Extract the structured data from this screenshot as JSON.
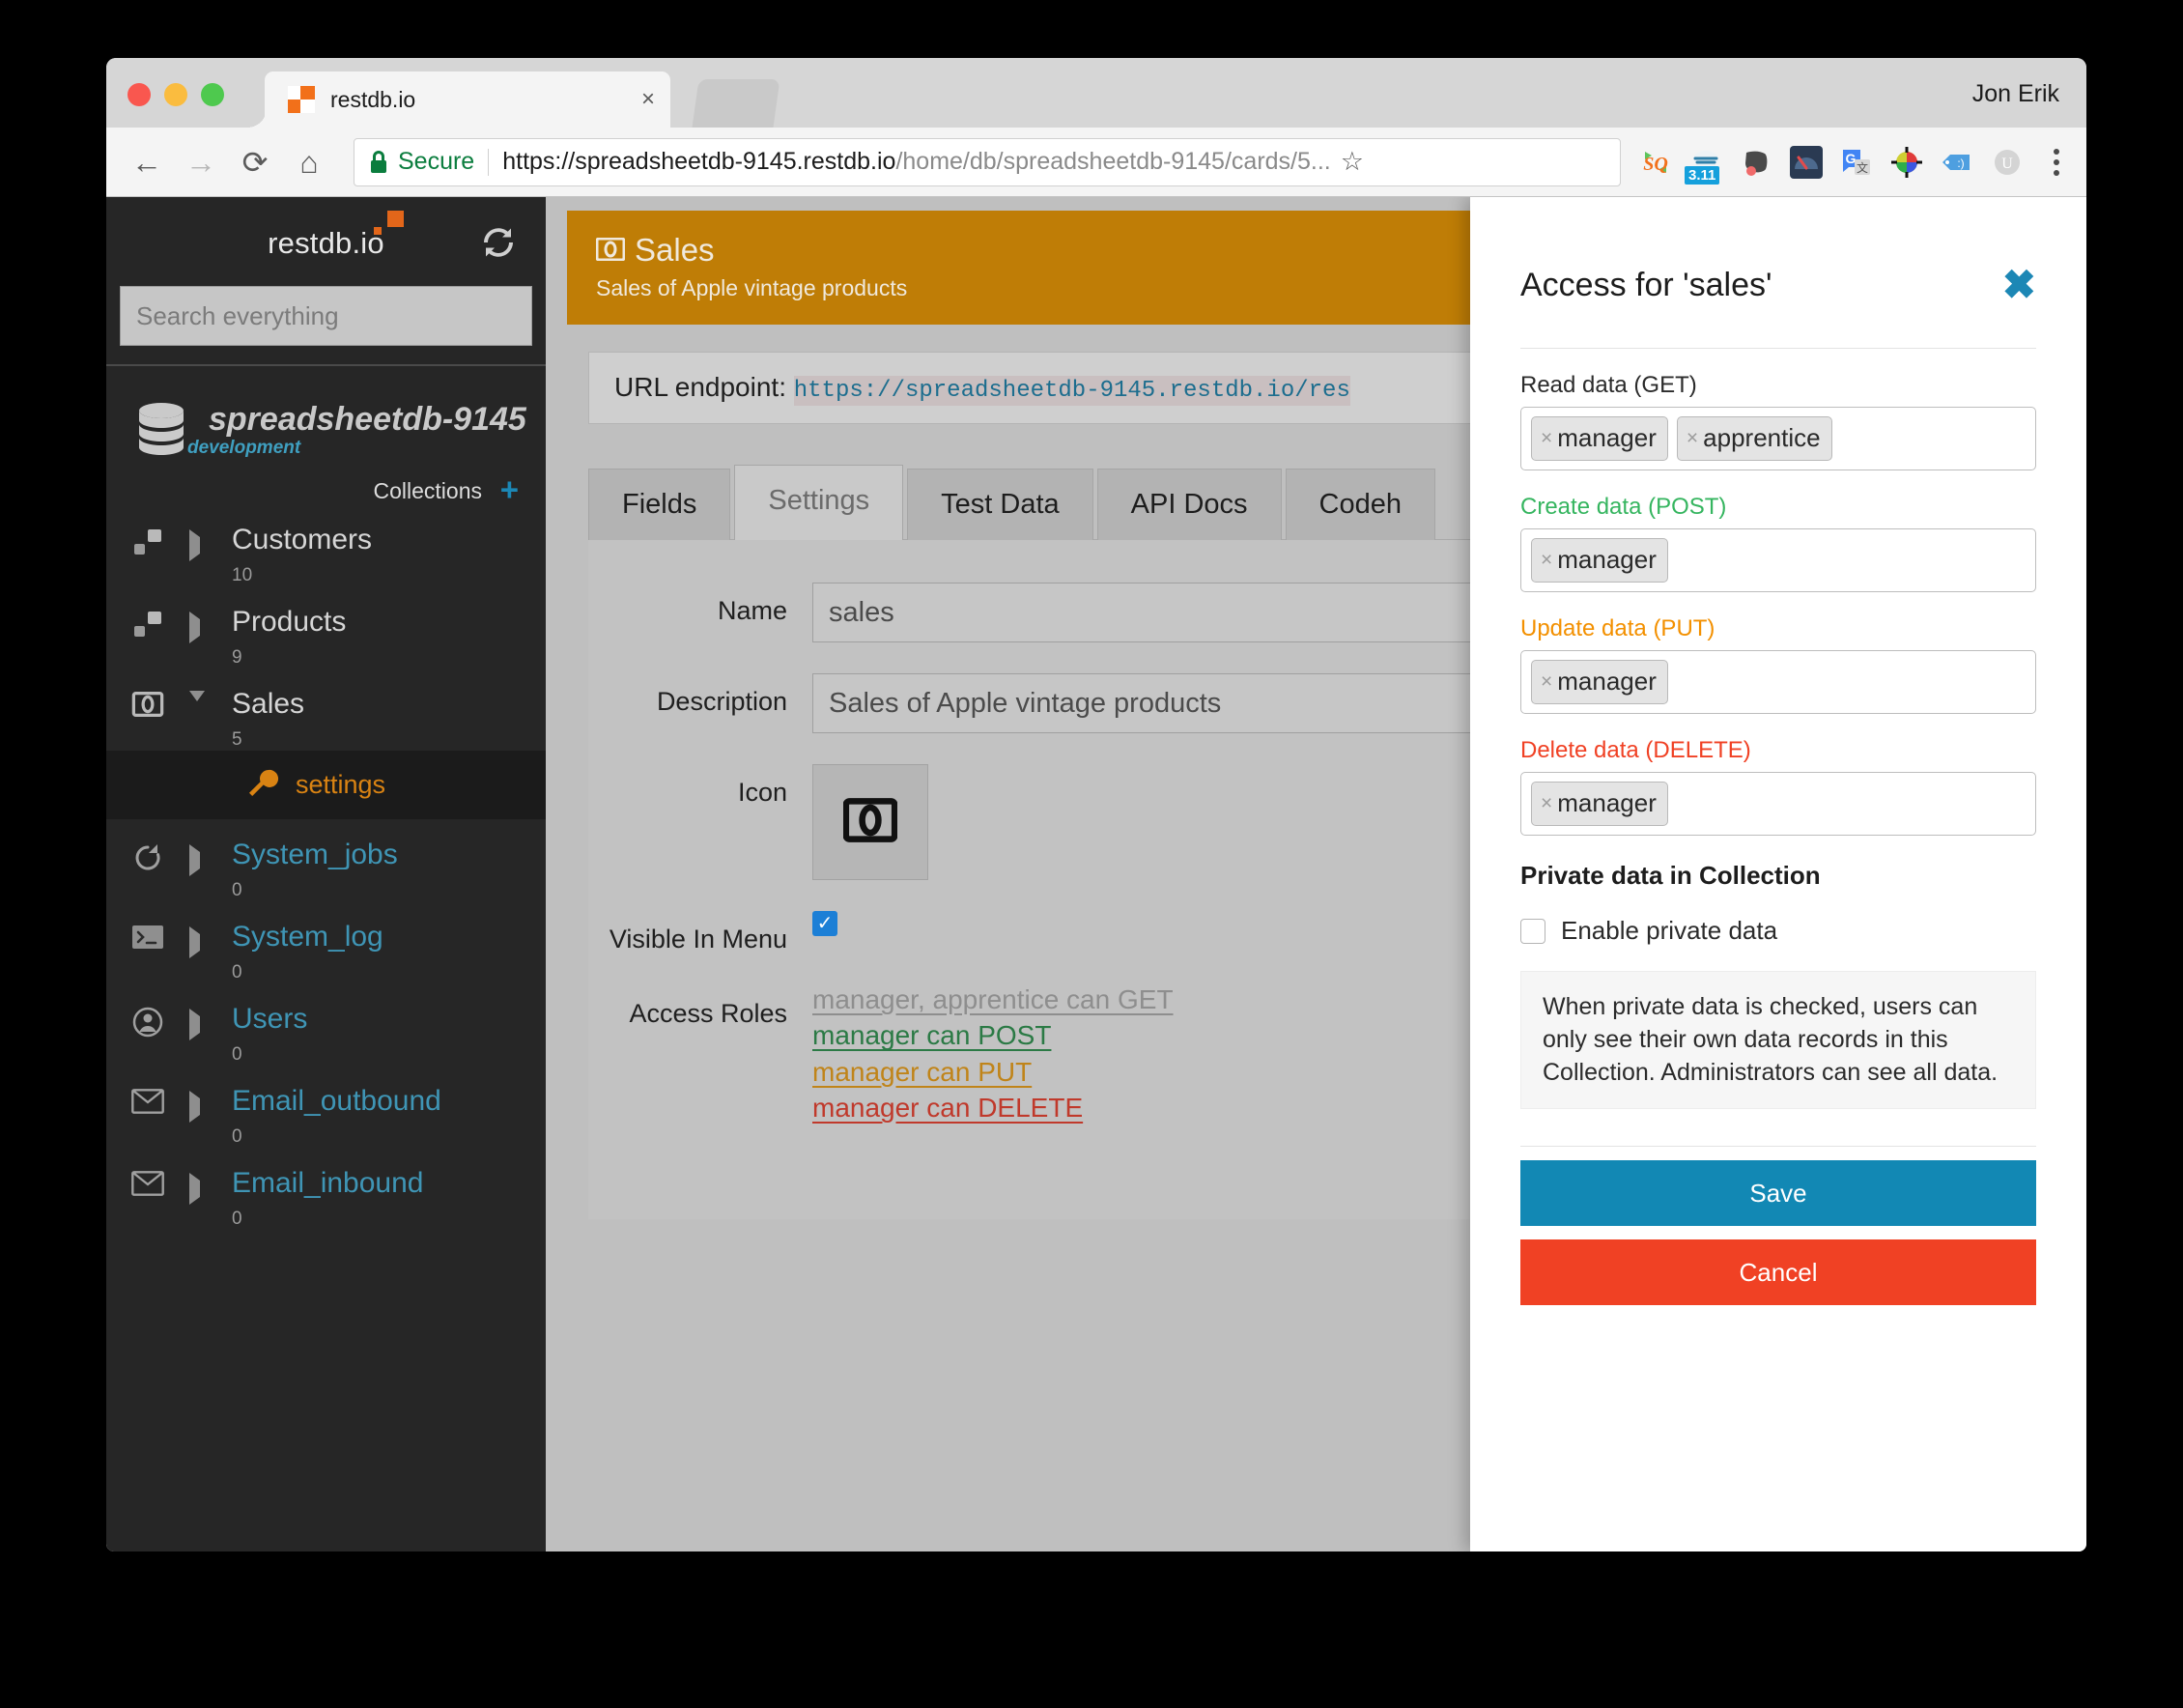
{
  "browser": {
    "tab_title": "restdb.io",
    "tab_close_glyph": "×",
    "profile_name": "Jon Erik",
    "nav": {
      "back": "←",
      "forward": "→",
      "reload": "⟳",
      "home": "⌂"
    },
    "omnibox": {
      "secure_label": "Secure",
      "url_host": "https://spreadsheetdb-9145.restdb.io",
      "url_path": "/home/db/spreadsheetdb-9145/cards/5...",
      "star_glyph": "☆"
    },
    "extensions": [
      {
        "name": "squarespace-extension-icon",
        "glyph": "SQ"
      },
      {
        "name": "pocket-extension-icon",
        "badge": "3.11"
      },
      {
        "name": "evernote-extension-icon"
      },
      {
        "name": "speedtest-extension-icon"
      },
      {
        "name": "google-translate-extension-icon",
        "glyph": "G"
      },
      {
        "name": "colorpicker-extension-icon"
      },
      {
        "name": "tag-extension-icon",
        "glyph": ":)"
      },
      {
        "name": "ublock-extension-icon",
        "glyph": "U"
      }
    ]
  },
  "sidebar": {
    "brand": "restdb.io",
    "refresh_icon": "refresh-icon",
    "search": {
      "placeholder": "Search everything",
      "value": ""
    },
    "database": {
      "name": "spreadsheetdb-9145",
      "environment": "development"
    },
    "collections_label": "Collections",
    "collections_add_glyph": "+",
    "collections": [
      {
        "label": "Customers",
        "count": "10",
        "icon": "nodes-icon",
        "expanded": false,
        "kind": "user"
      },
      {
        "label": "Products",
        "count": "9",
        "icon": "nodes-icon",
        "expanded": false,
        "kind": "user"
      },
      {
        "label": "Sales",
        "count": "5",
        "icon": "banknote-icon",
        "expanded": true,
        "kind": "user"
      },
      {
        "label": "System_jobs",
        "count": "0",
        "icon": "refresh-icon",
        "expanded": false,
        "kind": "system"
      },
      {
        "label": "System_log",
        "count": "0",
        "icon": "terminal-icon",
        "expanded": false,
        "kind": "system"
      },
      {
        "label": "Users",
        "count": "0",
        "icon": "user-icon",
        "expanded": false,
        "kind": "system"
      },
      {
        "label": "Email_outbound",
        "count": "0",
        "icon": "envelope-icon",
        "expanded": false,
        "kind": "system"
      },
      {
        "label": "Email_inbound",
        "count": "0",
        "icon": "envelope-icon",
        "expanded": false,
        "kind": "system"
      }
    ],
    "settings_item": {
      "label": "settings",
      "icon": "wrench-icon"
    }
  },
  "main": {
    "collection_header": {
      "icon": "banknote-icon",
      "title": "Sales",
      "description": "Sales of Apple vintage products"
    },
    "endpoint": {
      "label": "URL endpoint:",
      "url": "https://spreadsheetdb-9145.restdb.io/res"
    },
    "tabs": [
      {
        "label": "Fields",
        "active": false
      },
      {
        "label": "Settings",
        "active": true
      },
      {
        "label": "Test Data",
        "active": false
      },
      {
        "label": "API Docs",
        "active": false
      },
      {
        "label": "Codeh",
        "active": false
      }
    ],
    "settings_form": {
      "name_label": "Name",
      "name_value": "sales",
      "description_label": "Description",
      "description_value": "Sales of Apple vintage products",
      "icon_label": "Icon",
      "icon_name": "banknote-icon",
      "visible_label": "Visible In Menu",
      "visible_checked": true,
      "visible_check_glyph": "✓",
      "access_roles_label": "Access Roles",
      "access_roles": [
        {
          "text": "manager, apprentice can GET",
          "method": "GET"
        },
        {
          "text": "manager can POST",
          "method": "POST"
        },
        {
          "text": "manager can PUT",
          "method": "PUT"
        },
        {
          "text": "manager can DELETE",
          "method": "DELETE"
        }
      ]
    }
  },
  "modal": {
    "title": "Access for 'sales'",
    "close_glyph": "✖",
    "sections": [
      {
        "label": "Read data (GET)",
        "chips": [
          "manager",
          "apprentice"
        ]
      },
      {
        "label": "Create data (POST)",
        "chips": [
          "manager"
        ]
      },
      {
        "label": "Update data (PUT)",
        "chips": [
          "manager"
        ]
      },
      {
        "label": "Delete data (DELETE)",
        "chips": [
          "manager"
        ]
      }
    ],
    "chip_remove_glyph": "×",
    "private_heading": "Private data in Collection",
    "private_checkbox_label": "Enable private data",
    "private_checked": false,
    "private_note": "When private data is checked, users can only see their own data records in this Collection. Administrators can see all data.",
    "save_label": "Save",
    "cancel_label": "Cancel"
  },
  "colors": {
    "accent_blue": "#1288b4",
    "danger_red": "#f04124",
    "brand_orange": "#e2661a",
    "header_gold": "#bf7d06",
    "post_green": "#35b55f",
    "put_orange": "#f39000",
    "sidebar_bg": "#262626"
  }
}
